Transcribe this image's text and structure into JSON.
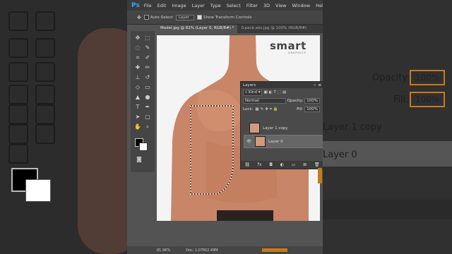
{
  "app": {
    "logo": "Ps"
  },
  "menu": [
    "File",
    "Edit",
    "Image",
    "Layer",
    "Type",
    "Select",
    "Filter",
    "3D",
    "View",
    "Window",
    "Help"
  ],
  "options": {
    "auto_select": "Auto-Select",
    "target": "Layer",
    "show_transform": "Show Transform Controls"
  },
  "tabs": [
    {
      "label": "Model.jpg @ 82% (Layer 0, RGB/8#) *"
    },
    {
      "label": "0.pack.abs.jpg @ 100% (RGB/8#)"
    }
  ],
  "canvas": {
    "brand": "smart",
    "brand_sub": "GRAPHICS"
  },
  "layers_panel": {
    "title": "Layers",
    "kind": "Kind",
    "blend_mode": "Normal",
    "opacity_label": "Opacity:",
    "opacity_value": "100%",
    "lock_label": "Lock:",
    "fill_label": "Fill:",
    "fill_value": "100%",
    "layers": [
      {
        "name": "Layer 1 copy",
        "selected": false
      },
      {
        "name": "Layer 0",
        "selected": true
      }
    ]
  },
  "status": {
    "zoom": "81.96%",
    "doc": "Doc: 1.07M/2.49M"
  },
  "background_panel": {
    "opacity_label": "Opacity:",
    "opacity_value": "100%",
    "fill_label": "Fill:",
    "fill_value": "100%",
    "layer_a": "Layer 1 copy",
    "layer_b": "Layer 0"
  },
  "colors": {
    "accent": "#31a8ff",
    "selection_orange": "#c77a1c"
  }
}
